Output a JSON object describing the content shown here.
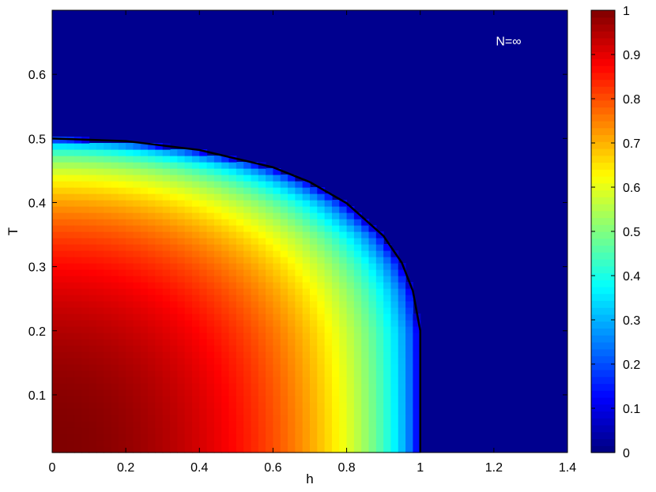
{
  "chart_data": {
    "type": "heatmap",
    "title": "",
    "xlabel": "h",
    "ylabel": "T",
    "xlim": [
      0,
      1.4
    ],
    "ylim": [
      0.01,
      0.7
    ],
    "x_ticks": [
      "0",
      "0.2",
      "0.4",
      "0.6",
      "0.8",
      "1",
      "1.2",
      "1.4"
    ],
    "x_tick_values": [
      0,
      0.2,
      0.4,
      0.6,
      0.8,
      1.0,
      1.2,
      1.4
    ],
    "y_ticks": [
      "0.1",
      "0.2",
      "0.3",
      "0.4",
      "0.5",
      "0.6"
    ],
    "y_tick_values": [
      0.1,
      0.2,
      0.3,
      0.4,
      0.5,
      0.6
    ],
    "colorbar": {
      "min": 0,
      "max": 1,
      "colormap": "jet",
      "ticks": [
        "0",
        "0.1",
        "0.2",
        "0.3",
        "0.4",
        "0.5",
        "0.6",
        "0.7",
        "0.8",
        "0.9",
        "1"
      ],
      "tick_values": [
        0,
        0.1,
        0.2,
        0.3,
        0.4,
        0.5,
        0.6,
        0.7,
        0.8,
        0.9,
        1.0
      ]
    },
    "annotation": "N=∞",
    "phase_boundary": {
      "color": "#000000",
      "h": [
        0,
        0.2,
        0.4,
        0.6,
        0.7,
        0.8,
        0.9,
        0.95,
        0.98,
        1.0,
        1.0
      ],
      "T": [
        0.5,
        0.496,
        0.482,
        0.455,
        0.432,
        0.399,
        0.348,
        0.306,
        0.262,
        0.2,
        0.01
      ]
    },
    "grid": false,
    "background_color": "#00008f"
  }
}
